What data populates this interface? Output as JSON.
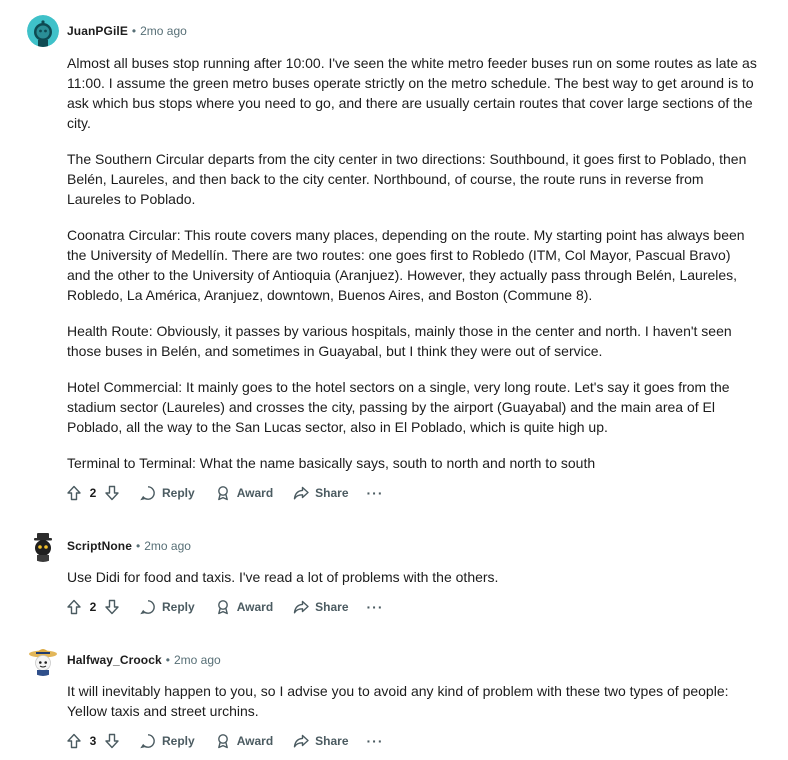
{
  "comments": [
    {
      "author": "JuanPGilE",
      "time": "2mo ago",
      "avatar_icon": "snoo-avatar-teal",
      "paragraphs": [
        "Almost all buses stop running after 10:00. I've seen the white metro feeder buses run on some routes as late as 11:00. I assume the green metro buses operate strictly on the metro schedule. The best way to get around is to ask which bus stops where you need to go, and there are usually certain routes that cover large sections of the city.",
        "The Southern Circular departs from the city center in two directions: Southbound, it goes first to Poblado, then Belén, Laureles, and then back to the city center. Northbound, of course, the route runs in reverse from Laureles to Poblado.",
        "Coonatra Circular: This route covers many places, depending on the route. My starting point has always been the University of Medellín. There are two routes: one goes first to Robledo (ITM, Col Mayor, Pascual Bravo) and the other to the University of Antioquia (Aranjuez). However, they actually pass through Belén, Laureles, Robledo, La América, Aranjuez, downtown, Buenos Aires, and Boston (Commune 8).",
        "Health Route: Obviously, it passes by various hospitals, mainly those in the center and north. I haven't seen those buses in Belén, and sometimes in Guayabal, but I think they were out of service.",
        "Hotel Commercial: It mainly goes to the hotel sectors on a single, very long route. Let's say it goes from the stadium sector (Laureles) and crosses the city, passing by the airport (Guayabal) and the main area of El Poblado, all the way to the San Lucas sector, also in El Poblado, which is quite high up.",
        "Terminal to Terminal: What the name basically says, south to north and north to south"
      ],
      "score": "2"
    },
    {
      "author": "ScriptNone",
      "time": "2mo ago",
      "avatar_icon": "snoo-avatar-dark-hat",
      "paragraphs": [
        "Use Didi for food and taxis. I've read a lot of problems with the others."
      ],
      "score": "2"
    },
    {
      "author": "Halfway_Croock",
      "time": "2mo ago",
      "avatar_icon": "snoo-avatar-straw-hat",
      "paragraphs": [
        "It will inevitably happen to you, so I advise you to avoid any kind of problem with these two types of people: Yellow taxis and street urchins."
      ],
      "score": "3"
    }
  ],
  "actions": {
    "reply": "Reply",
    "award": "Award",
    "share": "Share",
    "more": "···"
  },
  "separator": "•",
  "colors": {
    "text": "#1c1c1c",
    "meta": "#576f76",
    "action": "#4b5b61",
    "avatar_teal": "#3fc1c9"
  }
}
